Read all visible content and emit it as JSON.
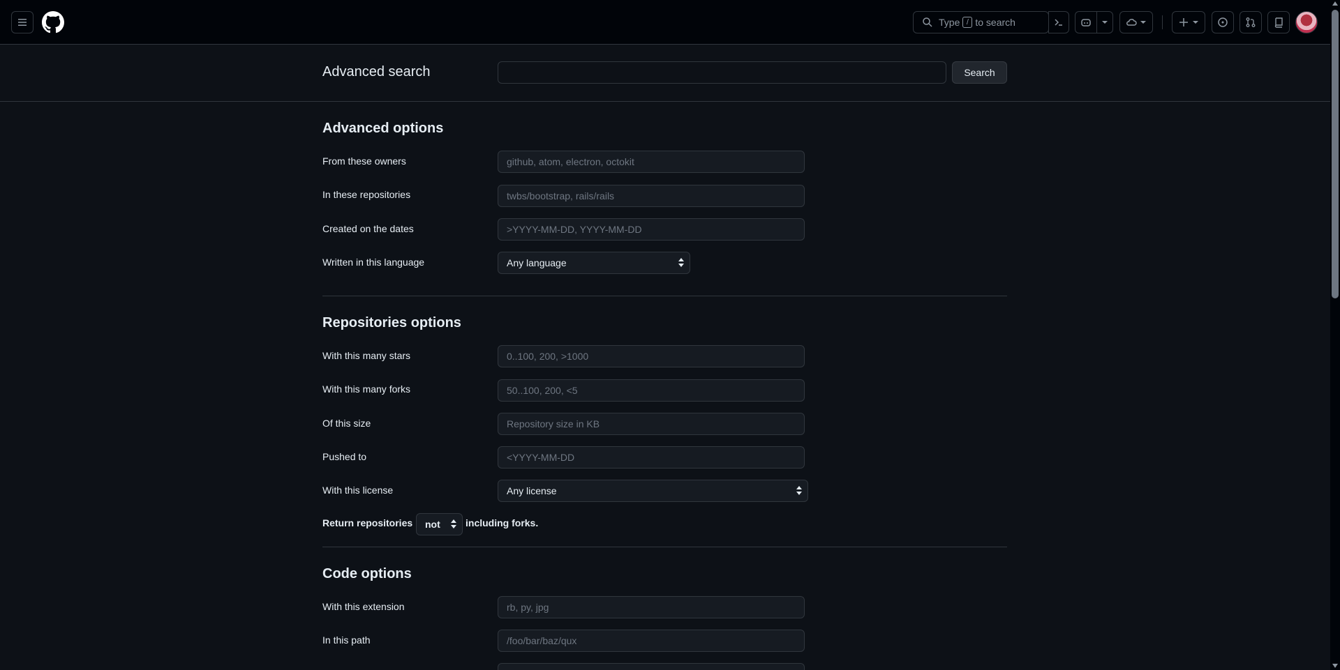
{
  "header": {
    "search_prefix": "Type",
    "search_key": "/",
    "search_suffix": "to search"
  },
  "page": {
    "title": "Advanced search",
    "search_value": "",
    "search_button": "Search"
  },
  "advanced": {
    "title": "Advanced options",
    "owners_label": "From these owners",
    "owners_placeholder": "github, atom, electron, octokit",
    "repos_label": "In these repositories",
    "repos_placeholder": "twbs/bootstrap, rails/rails",
    "dates_label": "Created on the dates",
    "dates_placeholder": ">YYYY-MM-DD, YYYY-MM-DD",
    "language_label": "Written in this language",
    "language_value": "Any language"
  },
  "repositories": {
    "title": "Repositories options",
    "stars_label": "With this many stars",
    "stars_placeholder": "0..100, 200, >1000",
    "forks_label": "With this many forks",
    "forks_placeholder": "50..100, 200, <5",
    "size_label": "Of this size",
    "size_placeholder": "Repository size in KB",
    "pushed_label": "Pushed to",
    "pushed_placeholder": "<YYYY-MM-DD",
    "license_label": "With this license",
    "license_value": "Any license",
    "return_prefix": "Return repositories",
    "return_value": "not",
    "return_suffix": "including forks."
  },
  "code": {
    "title": "Code options",
    "extension_label": "With this extension",
    "extension_placeholder": "rb, py, jpg",
    "path_label": "In this path",
    "path_placeholder": "/foo/bar/baz/qux"
  }
}
